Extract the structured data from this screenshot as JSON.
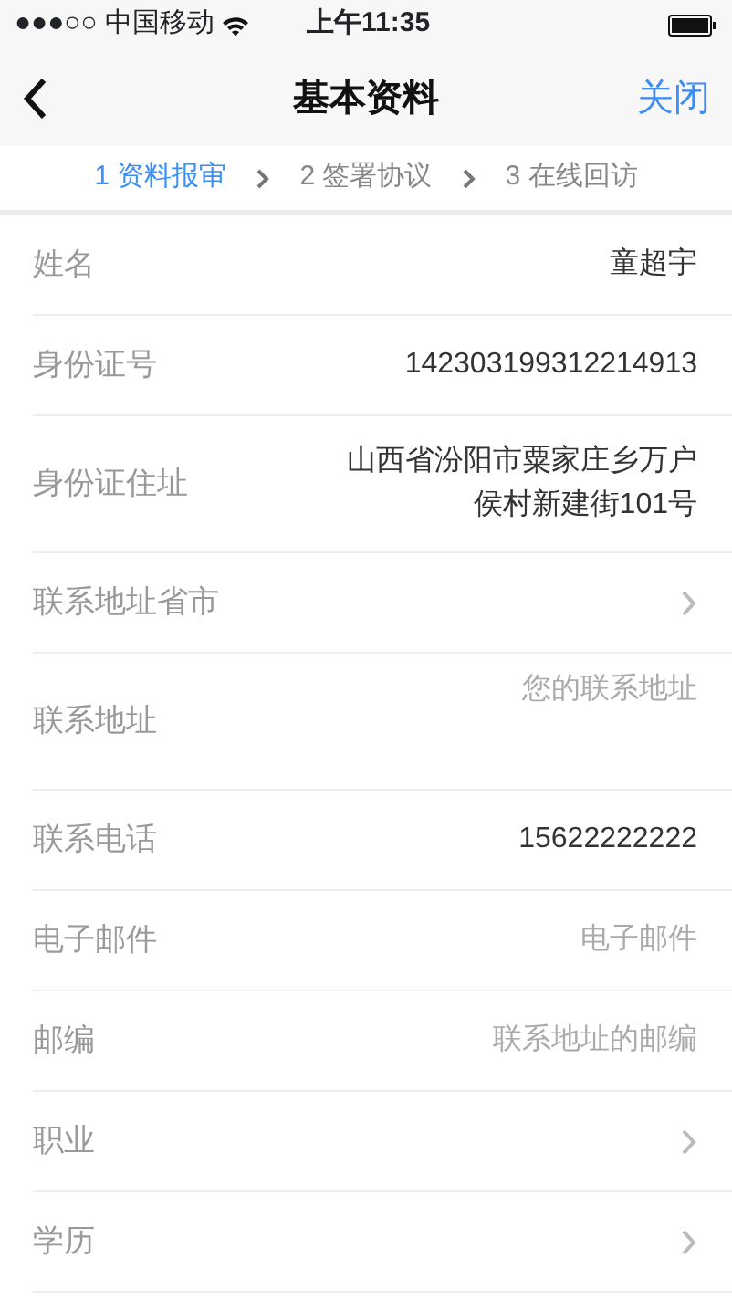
{
  "status_bar": {
    "signal": "●●●○○",
    "carrier": "中国移动",
    "time": "上午11:35"
  },
  "nav": {
    "title": "基本资料",
    "action": "关闭"
  },
  "steps": [
    {
      "label": "1 资料报审",
      "selected": true
    },
    {
      "label": "2 签署协议",
      "selected": false
    },
    {
      "label": "3 在线回访",
      "selected": false
    }
  ],
  "fields": [
    {
      "label": "姓名",
      "kind": "text",
      "value": "童超宇"
    },
    {
      "label": "身份证号",
      "kind": "text",
      "value": "142303199312214913"
    },
    {
      "label": "身份证住址",
      "kind": "text",
      "value": "山西省汾阳市粟家庄乡万户侯村新建街101号"
    },
    {
      "label": "联系地址省市",
      "kind": "select"
    },
    {
      "label": "联系地址",
      "kind": "area",
      "placeholder": "您的联系地址"
    },
    {
      "label": "联系电话",
      "kind": "text",
      "value": "15622222222"
    },
    {
      "label": "电子邮件",
      "kind": "input",
      "placeholder": "电子邮件"
    },
    {
      "label": "邮编",
      "kind": "input",
      "placeholder": "联系地址的邮编"
    },
    {
      "label": "职业",
      "kind": "select"
    },
    {
      "label": "学历",
      "kind": "select"
    }
  ]
}
